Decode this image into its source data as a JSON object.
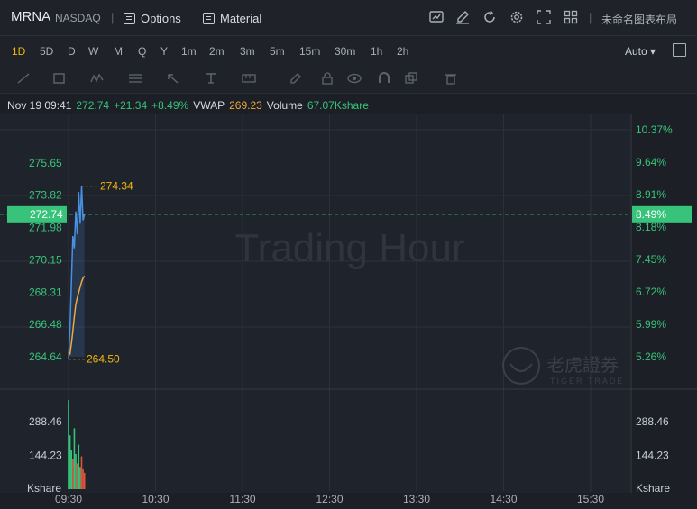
{
  "header": {
    "ticker": "MRNA",
    "exchange": "NASDAQ",
    "options_label": "Options",
    "material_label": "Material",
    "layout_label": "未命名图表布局"
  },
  "timeframes": [
    "1D",
    "5D",
    "D",
    "W",
    "M",
    "Q",
    "Y",
    "1m",
    "2m",
    "3m",
    "5m",
    "15m",
    "30m",
    "1h",
    "2h"
  ],
  "active_timeframe": "1D",
  "scale_mode": "Auto ▾",
  "info_line": {
    "date": "Nov 19 09:41",
    "price": "272.74",
    "change": "+21.34",
    "change_pct": "+8.49%",
    "vwap_label": "VWAP",
    "vwap": "269.23",
    "volume_label": "Volume",
    "volume": "67.07Kshare"
  },
  "watermark": "Trading Hour",
  "brand": {
    "cn": "老虎證券",
    "en": "TIGER TRADE"
  },
  "colors": {
    "up": "#38c37a",
    "accent": "#f0b90b",
    "price_line": "#4a90e2",
    "vwap_line": "#f0a93b",
    "down": "#e0533d"
  },
  "chart_data": {
    "type": "line",
    "price_axis_left": [
      "275.65",
      "273.82",
      "271.98",
      "270.15",
      "268.31",
      "266.48",
      "264.64"
    ],
    "price_axis_values": [
      275.65,
      273.82,
      271.98,
      270.15,
      268.31,
      266.48,
      264.64
    ],
    "pct_axis_right": [
      "10.37%",
      "9.64%",
      "8.91%",
      "8.18%",
      "7.45%",
      "6.72%",
      "5.99%",
      "5.26%"
    ],
    "pct_axis_values": [
      10.37,
      9.64,
      8.91,
      8.18,
      7.45,
      6.72,
      5.99,
      5.26
    ],
    "current_price_label": "272.74",
    "current_pct_label": "8.49%",
    "high_label": "274.34",
    "low_label": "264.50",
    "x_ticks": [
      "09:30",
      "10:30",
      "11:30",
      "12:30",
      "13:30",
      "14:30",
      "15:30"
    ],
    "volume_axis": [
      "288.46",
      "144.23",
      "Kshare"
    ],
    "volume_axis_values": [
      288.46,
      144.23
    ],
    "price_series": [
      {
        "t": "09:30",
        "v": 264.5
      },
      {
        "t": "09:31",
        "v": 266.2
      },
      {
        "t": "09:32",
        "v": 268.9
      },
      {
        "t": "09:33",
        "v": 271.5
      },
      {
        "t": "09:34",
        "v": 270.8
      },
      {
        "t": "09:35",
        "v": 272.9
      },
      {
        "t": "09:36",
        "v": 271.6
      },
      {
        "t": "09:37",
        "v": 274.0
      },
      {
        "t": "09:38",
        "v": 272.2
      },
      {
        "t": "09:39",
        "v": 274.34
      },
      {
        "t": "09:40",
        "v": 272.4
      },
      {
        "t": "09:41",
        "v": 272.74
      }
    ],
    "vwap_series": [
      {
        "t": "09:30",
        "v": 264.9
      },
      {
        "t": "09:31",
        "v": 264.8
      },
      {
        "t": "09:32",
        "v": 265.4
      },
      {
        "t": "09:33",
        "v": 266.1
      },
      {
        "t": "09:34",
        "v": 266.9
      },
      {
        "t": "09:35",
        "v": 267.6
      },
      {
        "t": "09:36",
        "v": 268.0
      },
      {
        "t": "09:37",
        "v": 268.3
      },
      {
        "t": "09:38",
        "v": 268.6
      },
      {
        "t": "09:39",
        "v": 268.9
      },
      {
        "t": "09:40",
        "v": 269.1
      },
      {
        "t": "09:41",
        "v": 269.23
      }
    ],
    "volume_series": [
      {
        "t": "09:30",
        "v": 380,
        "dir": "up"
      },
      {
        "t": "09:31",
        "v": 230,
        "dir": "up"
      },
      {
        "t": "09:32",
        "v": 165,
        "dir": "up"
      },
      {
        "t": "09:33",
        "v": 130,
        "dir": "down"
      },
      {
        "t": "09:34",
        "v": 260,
        "dir": "up"
      },
      {
        "t": "09:35",
        "v": 150,
        "dir": "up"
      },
      {
        "t": "09:36",
        "v": 110,
        "dir": "down"
      },
      {
        "t": "09:37",
        "v": 190,
        "dir": "up"
      },
      {
        "t": "09:38",
        "v": 95,
        "dir": "up"
      },
      {
        "t": "09:39",
        "v": 140,
        "dir": "down"
      },
      {
        "t": "09:40",
        "v": 85,
        "dir": "down"
      },
      {
        "t": "09:41",
        "v": 70,
        "dir": "down"
      }
    ]
  }
}
